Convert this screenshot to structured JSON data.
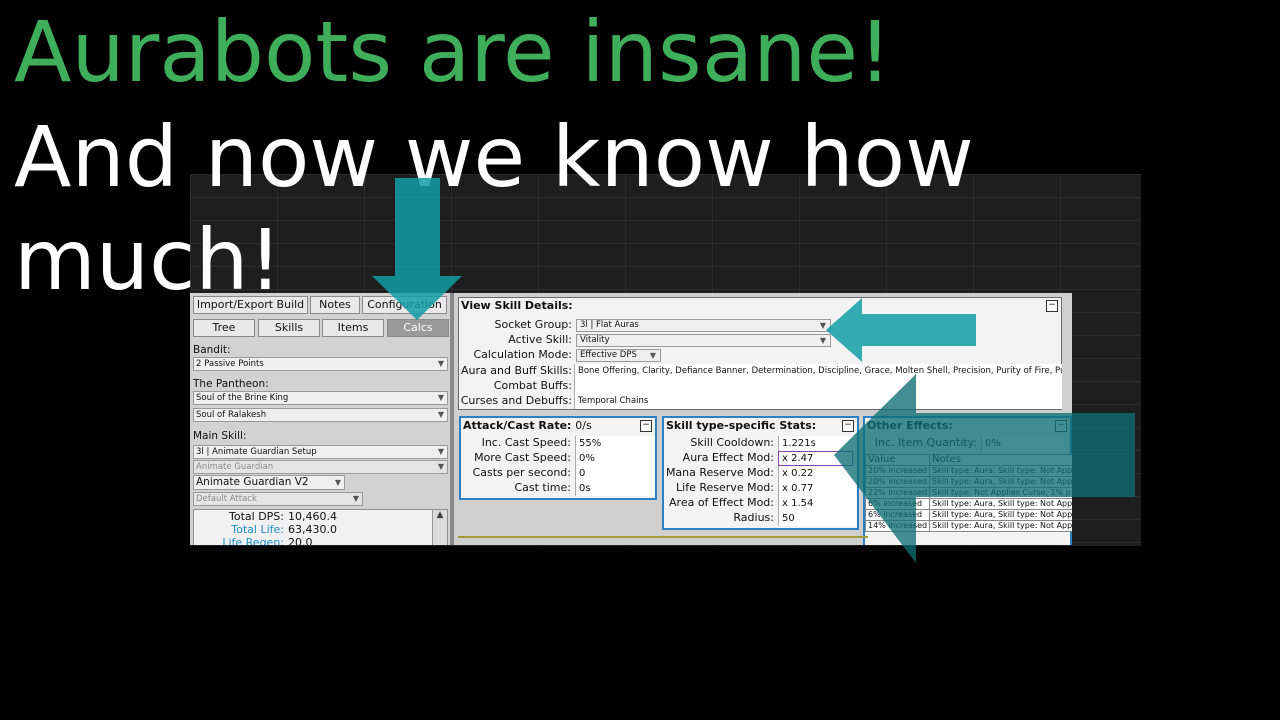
{
  "titles": {
    "line1": "Aurabots are insane!",
    "line2": "And now we know how",
    "line3": "much!"
  },
  "colors": {
    "title_accent": "#3fae5a",
    "arrow_teal": "#129ea5",
    "panel_border": "#2b7fc4"
  },
  "nav": {
    "import_export": "Import/Export Build",
    "notes": "Notes",
    "configuration": "Configuration",
    "tree": "Tree",
    "skills": "Skills",
    "items": "Items",
    "calcs": "Calcs"
  },
  "sidebar": {
    "bandit_label": "Bandit:",
    "bandit_value": "2 Passive Points",
    "pantheon_label": "The Pantheon:",
    "pantheon_major": "Soul of the Brine King",
    "pantheon_minor": "Soul of Ralakesh",
    "main_skill_label": "Main Skill:",
    "main_skill_value": "3l | Animate Guardian Setup",
    "main_skill_sub": "Animate Guardian",
    "main_skill_version": "Animate Guardian V2",
    "main_skill_attack": "Default Attack",
    "stats": [
      {
        "label": "Total DPS:",
        "value": "10,460.4"
      },
      {
        "label": "Total Life:",
        "value": "63,430.0"
      },
      {
        "label": "Life Regen:",
        "value": "20.0"
      }
    ]
  },
  "view_skill": {
    "header": "View Skill Details:",
    "rows": [
      {
        "label": "Socket Group:",
        "value": "3l | Flat Auras"
      },
      {
        "label": "Active Skill:",
        "value": "Vitality"
      },
      {
        "label": "Calculation Mode:",
        "value": "Effective DPS"
      },
      {
        "label": "Aura and Buff Skills:",
        "value": "Bone Offering, Clarity, Defiance Banner, Determination, Discipline, Grace, Molten Shell, Precision, Purity of Fire, Purity"
      },
      {
        "label": "Combat Buffs:",
        "value": ""
      },
      {
        "label": "Curses and Debuffs:",
        "value": "Temporal Chains"
      }
    ]
  },
  "attack_cast": {
    "header": "Attack/Cast Rate:",
    "header_value": "0/s",
    "rows": [
      {
        "label": "Inc. Cast Speed:",
        "value": "55%"
      },
      {
        "label": "More Cast Speed:",
        "value": "0%"
      },
      {
        "label": "Casts per second:",
        "value": "0"
      },
      {
        "label": "Cast time:",
        "value": "0s"
      }
    ]
  },
  "skill_type": {
    "header": "Skill type-specific Stats:",
    "rows": [
      {
        "label": "Skill Cooldown:",
        "value": "1.221s"
      },
      {
        "label": "Aura Effect Mod:",
        "value": "x 2.47"
      },
      {
        "label": "Mana Reserve Mod:",
        "value": "x 0.22"
      },
      {
        "label": "Life Reserve Mod:",
        "value": "x 0.77"
      },
      {
        "label": "Area of Effect Mod:",
        "value": "x 1.54"
      },
      {
        "label": "Radius:",
        "value": "50"
      }
    ]
  },
  "other_effects": {
    "header": "Other Effects:",
    "row_label": "Inc. Item Quantity:",
    "row_value": "0%",
    "col_value": "Value",
    "col_notes": "Notes",
    "table": [
      {
        "value": "20% increased",
        "notes": "Skill type: Aura, Skill type: Not App"
      },
      {
        "value": "20% increased",
        "notes": "Skill type: Aura, Skill type: Not App"
      },
      {
        "value": "22% increased",
        "notes": "Skill type: Not Applies Curse, 1% p"
      },
      {
        "value": "6% increased",
        "notes": "Skill type: Aura, Skill type: Not App"
      },
      {
        "value": "6% increased",
        "notes": "Skill type: Aura, Skill type: Not App"
      },
      {
        "value": "14% increased",
        "notes": "Skill type: Aura, Skill type: Not App"
      }
    ]
  },
  "minimize_glyph": "−",
  "dropdown_glyph": "▼",
  "scroll_up_glyph": "▲"
}
